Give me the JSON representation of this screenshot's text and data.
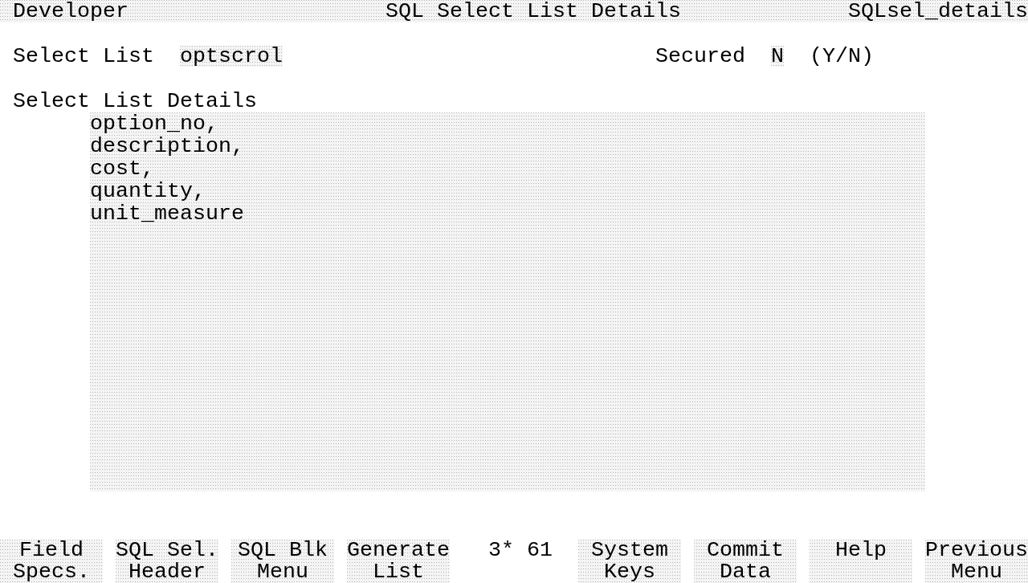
{
  "title_bar": {
    "app": "Developer",
    "title": "SQL Select List Details",
    "form": "SQLsel_details"
  },
  "select_list": {
    "label": "Select List",
    "value": "optscrol"
  },
  "secured": {
    "label": "Secured",
    "value": "N",
    "hint": "(Y/N)"
  },
  "details": {
    "label": "Select List Details",
    "lines": [
      "option_no,",
      "description,",
      "cost,",
      "quantity,",
      "unit_measure"
    ]
  },
  "status": "3* 61",
  "softkeys": [
    {
      "lines": [
        "Field",
        "Specs."
      ]
    },
    {
      "lines": [
        "SQL Sel.",
        "Header"
      ]
    },
    {
      "lines": [
        "SQL Blk",
        "Menu"
      ]
    },
    {
      "lines": [
        "Generate",
        "List"
      ]
    },
    {
      "lines": [
        "System",
        "Keys"
      ]
    },
    {
      "lines": [
        "Commit",
        "Data"
      ]
    },
    {
      "lines": [
        "Help"
      ]
    },
    {
      "lines": [
        "Previous",
        "Menu"
      ]
    }
  ]
}
